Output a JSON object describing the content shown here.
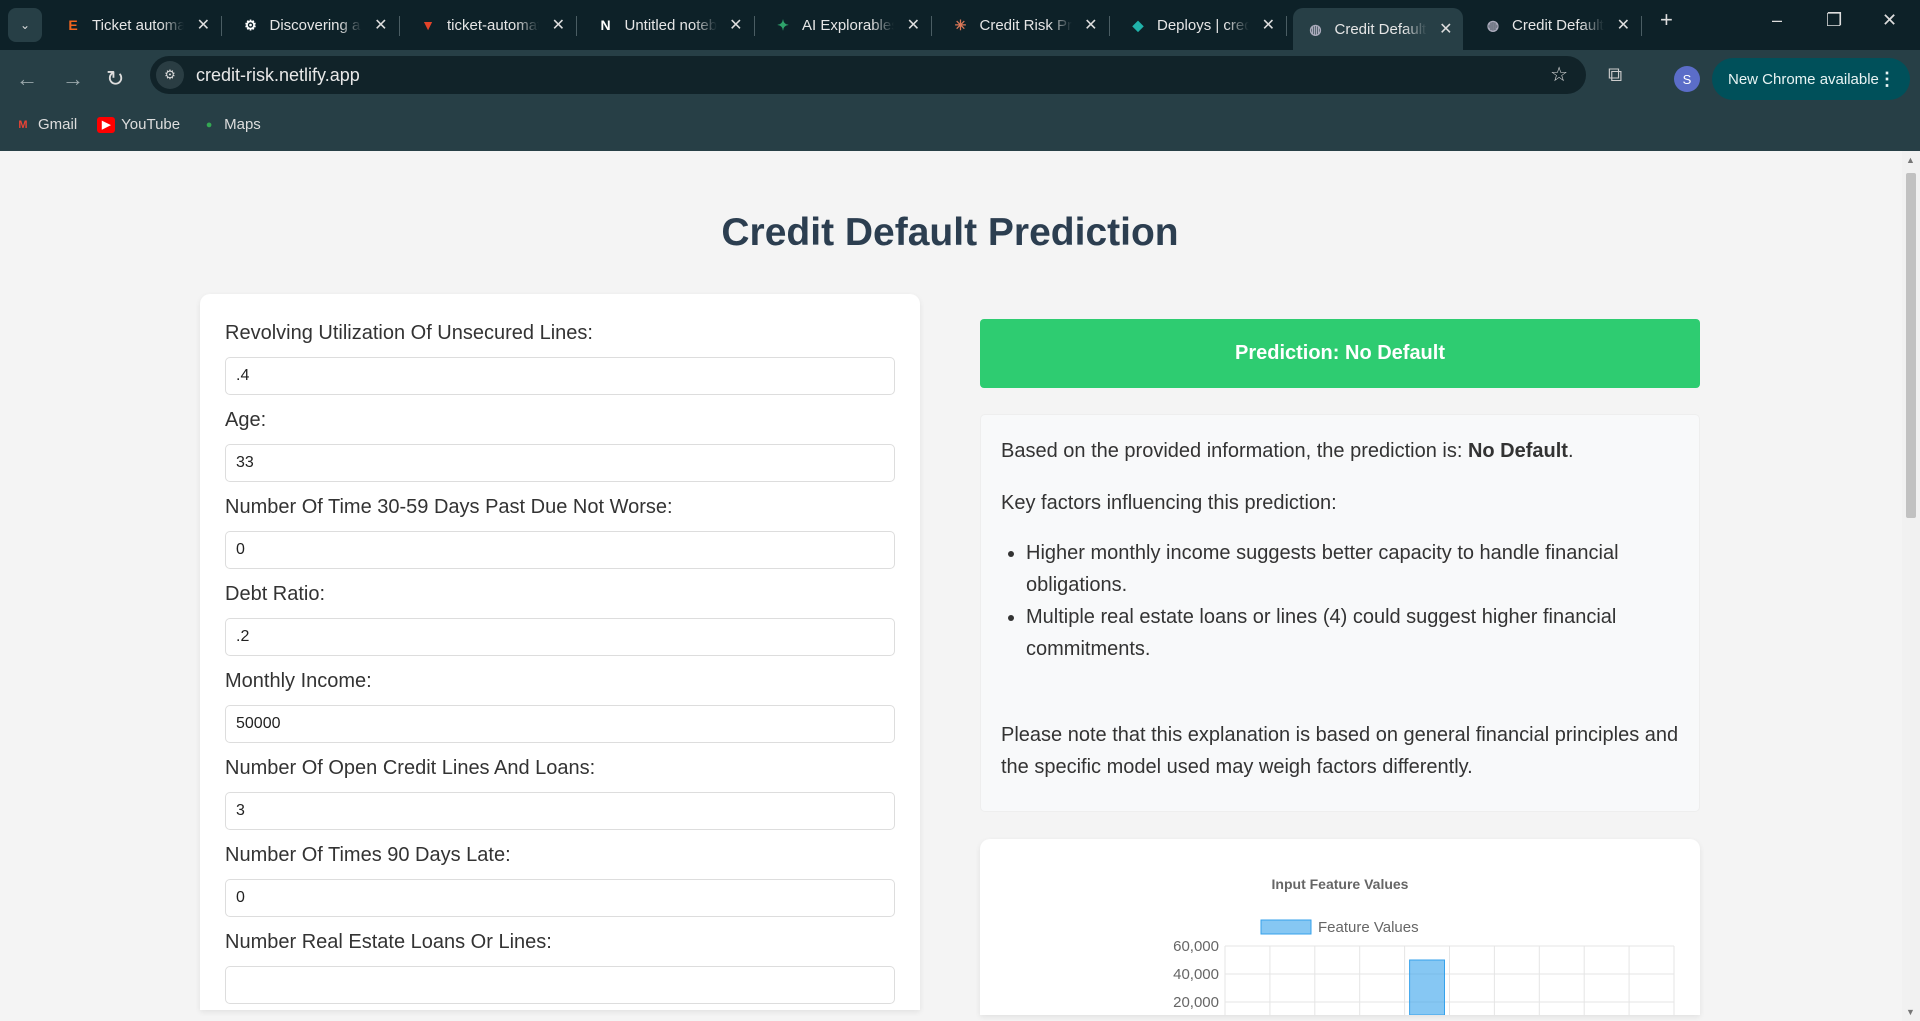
{
  "browser": {
    "tabs": [
      {
        "title": "Ticket automation",
        "icon": "etsy-icon",
        "active": false
      },
      {
        "title": "Discovering a",
        "icon": "gear-icon",
        "active": false
      },
      {
        "title": "ticket-automation",
        "icon": "gitlab-icon",
        "active": false
      },
      {
        "title": "Untitled notebook",
        "icon": "notion-icon",
        "active": false
      },
      {
        "title": "AI Explorables",
        "icon": "sparkle-icon",
        "active": false
      },
      {
        "title": "Credit Risk Prediction",
        "icon": "claude-icon",
        "active": false
      },
      {
        "title": "Deploys | credit",
        "icon": "netlify-icon",
        "active": false
      },
      {
        "title": "Credit Default Prediction",
        "icon": "globe-icon",
        "active": true
      },
      {
        "title": "Credit Default Prediction",
        "icon": "globe-icon",
        "active": false
      }
    ],
    "url": "credit-risk.netlify.app",
    "profile_initial": "S",
    "new_chrome_label": "New Chrome available",
    "bookmarks": [
      {
        "label": "Gmail",
        "icon": "gmail-icon"
      },
      {
        "label": "YouTube",
        "icon": "youtube-icon"
      },
      {
        "label": "Maps",
        "icon": "maps-icon"
      }
    ]
  },
  "page": {
    "title": "Credit Default Prediction",
    "fields": [
      {
        "label": "Revolving Utilization Of Unsecured Lines:",
        "value": ".4"
      },
      {
        "label": "Age:",
        "value": "33"
      },
      {
        "label": "Number Of Time 30-59 Days Past Due Not Worse:",
        "value": "0"
      },
      {
        "label": "Debt Ratio:",
        "value": ".2"
      },
      {
        "label": "Monthly Income:",
        "value": "50000"
      },
      {
        "label": "Number Of Open Credit Lines And Loans:",
        "value": "3"
      },
      {
        "label": "Number Of Times 90 Days Late:",
        "value": "0"
      },
      {
        "label": "Number Real Estate Loans Or Lines:",
        "value": ""
      }
    ],
    "prediction": "Prediction: No Default",
    "explanation": {
      "intro": "Based on the provided information, the prediction is: ",
      "intro_bold": "No Default",
      "intro_end": ".",
      "factors_heading": "Key factors influencing this prediction:",
      "factors": [
        "Higher monthly income suggests better capacity to handle financial obligations.",
        "Multiple real estate loans or lines (4) could suggest higher financial commitments."
      ],
      "note": "Please note that this explanation is based on general financial principles and the specific model used may weigh factors differently."
    }
  },
  "chart_data": {
    "type": "bar",
    "title": "Input Feature Values",
    "series": [
      {
        "name": "Feature Values",
        "values": [
          0.4,
          33,
          0,
          0.2,
          50000,
          3,
          0,
          4,
          null,
          null
        ],
        "color": "#36a2eb"
      }
    ],
    "category_count": 10,
    "yticks": [
      "60,000",
      "40,000",
      "20,000"
    ],
    "ylim": [
      0,
      60000
    ],
    "grid": true,
    "legend": "top"
  },
  "colors": {
    "success": "#2ecc71",
    "title": "#2c3e50",
    "bar": "#36a2eb"
  }
}
